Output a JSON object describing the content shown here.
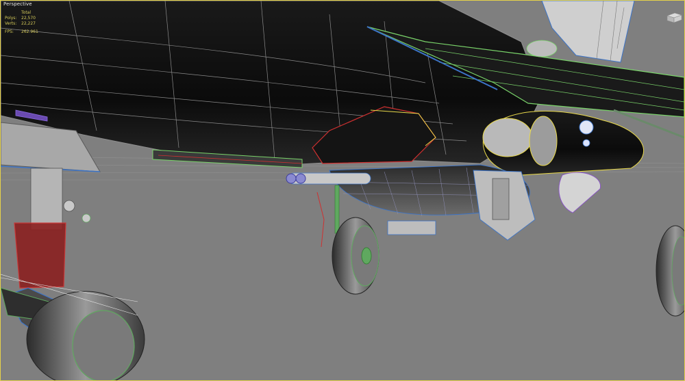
{
  "viewport": {
    "label": "Perspective",
    "stats": {
      "total_header": "Total",
      "polys_label": "Polys:",
      "polys_value": "22,570",
      "verts_label": "Verts:",
      "verts_value": "22,227",
      "fps_label": "FPS:",
      "fps_value": "262.961"
    }
  },
  "colors": {
    "viewport_bg": "#7f7f7f",
    "active_border": "#e6d24a",
    "stats_text": "#d7cc5a",
    "fuselage": "#050505",
    "wire_gray": "#9a9a9a",
    "wire_green": "#7ad46a",
    "wire_red": "#d03030",
    "wire_blue": "#3c74c8",
    "wire_yellow": "#e8d84a",
    "wire_purple": "#8a4ad0"
  },
  "icons": {
    "viewcube": "viewcube-icon"
  }
}
